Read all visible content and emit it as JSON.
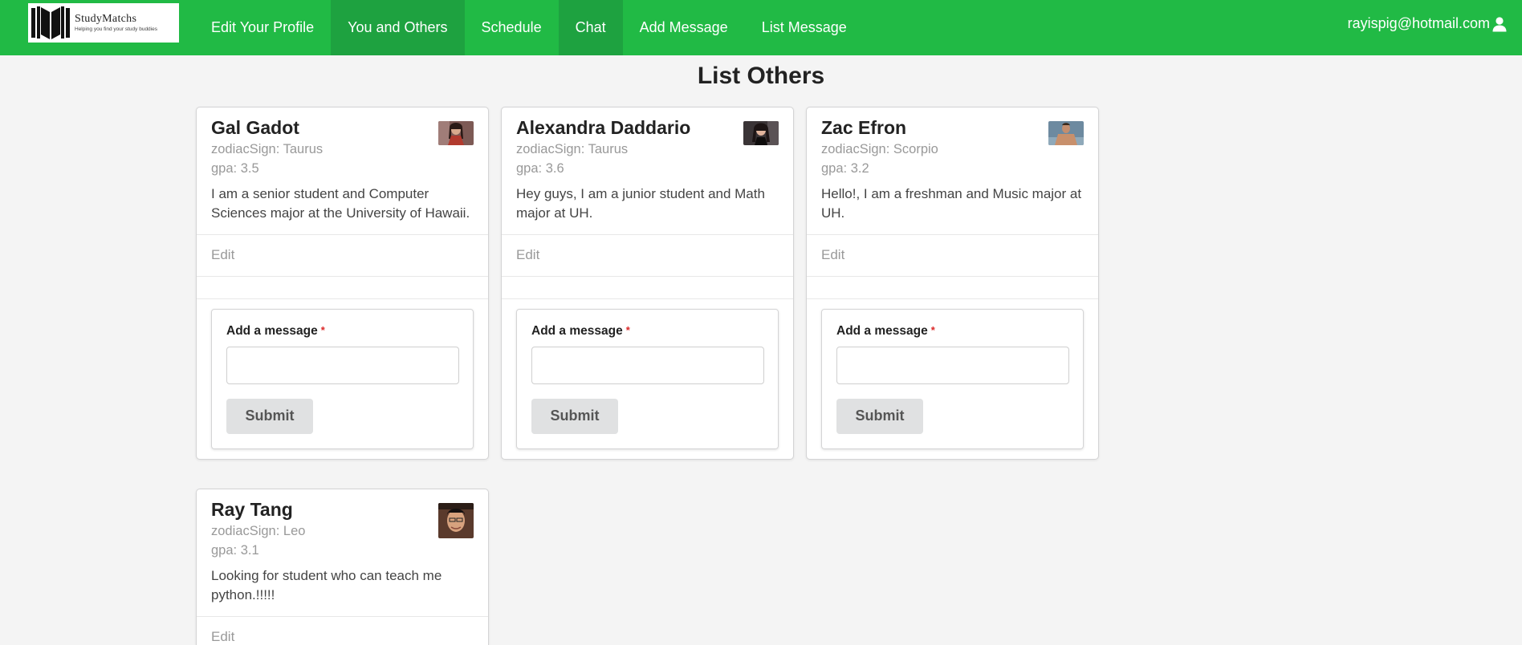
{
  "brand": {
    "name": "StudyMatchs",
    "tagline": "Helping you find your study buddies"
  },
  "nav": {
    "items": [
      {
        "label": "Edit Your Profile",
        "active": false
      },
      {
        "label": "You and Others",
        "active": true
      },
      {
        "label": "Schedule",
        "active": false
      },
      {
        "label": "Chat",
        "active": true
      },
      {
        "label": "Add Message",
        "active": false
      },
      {
        "label": "List Message",
        "active": false
      }
    ],
    "user_email": "rayispig@hotmail.com",
    "user_icon": "user-icon"
  },
  "page_title": "List Others",
  "form": {
    "label": "Add a message",
    "required_mark": "*",
    "submit_label": "Submit",
    "input_value": ""
  },
  "cards": [
    {
      "name": "Gal Gadot",
      "zodiac": "zodiacSign: Taurus",
      "gpa": "gpa: 3.5",
      "description": "I am a senior student and Computer Sciences major at the University of Hawaii.",
      "edit_label": "Edit"
    },
    {
      "name": "Alexandra Daddario",
      "zodiac": "zodiacSign: Taurus",
      "gpa": "gpa: 3.6",
      "description": "Hey guys, I am a junior student and Math major at UH.",
      "edit_label": "Edit"
    },
    {
      "name": "Zac Efron",
      "zodiac": "zodiacSign: Scorpio",
      "gpa": "gpa: 3.2",
      "description": "Hello!, I am a freshman and Music major at UH.",
      "edit_label": "Edit"
    },
    {
      "name": "Ray Tang",
      "zodiac": "zodiacSign: Leo",
      "gpa": "gpa: 3.1",
      "description": "Looking for student who can teach me python.!!!!!",
      "edit_label": "Edit"
    }
  ],
  "colors": {
    "navbar": "#21ba45",
    "navbar_active": "#1ea240",
    "page_bg": "#f4f4f4",
    "required": "#db2828",
    "button_bg": "#e0e1e2"
  }
}
